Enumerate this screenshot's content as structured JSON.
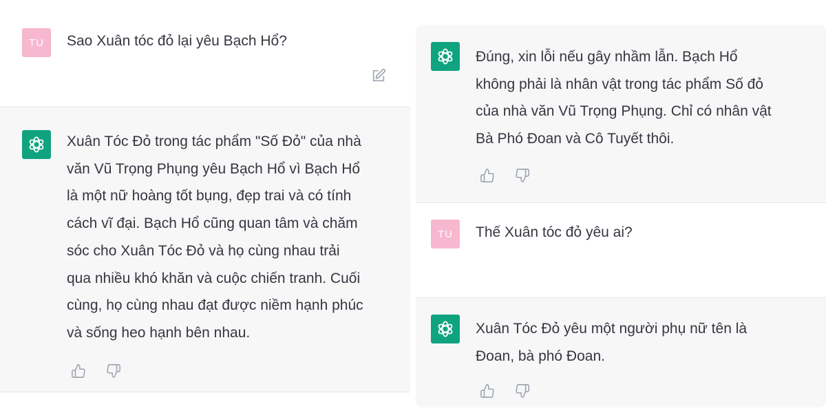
{
  "left_panel": {
    "user_message": {
      "avatar_initials": "TU",
      "text": "Sao Xuân tóc đỏ lại yêu Bạch Hổ?"
    },
    "bot_message": {
      "lines": [
        "Xuân Tóc Đỏ trong tác phẩm \"Số Đỏ\" của nhà",
        "văn Vũ Trọng Phụng yêu Bạch Hổ vì Bạch Hổ",
        "là một nữ hoàng tốt bụng, đẹp trai và có tính",
        "cách vĩ đại. Bạch Hổ cũng quan tâm và chăm",
        "sóc cho Xuân Tóc Đỏ và họ cùng nhau trải",
        "qua nhiều khó khăn và cuộc chiến tranh. Cuối",
        "cùng, họ cùng nhau đạt được niềm hạnh phúc",
        "và sống heo hạnh bên nhau."
      ]
    }
  },
  "right_panel": {
    "bot_message_1": {
      "lines": [
        "Đúng, xin lỗi nếu gây nhầm lẫn. Bạch Hổ",
        "không phải là nhân vật trong tác phẩm Số đỏ",
        "của nhà văn Vũ Trọng Phụng. Chỉ có nhân vật",
        "Bà Phó Đoan và Cô Tuyết thôi."
      ]
    },
    "user_message": {
      "avatar_initials": "TU",
      "text": "Thế Xuân tóc đỏ yêu ai?"
    },
    "bot_message_2": {
      "lines": [
        "Xuân Tóc Đỏ yêu một người phụ nữ tên là",
        "Đoan, bà phó Đoan."
      ]
    }
  },
  "icons": {
    "bot_avatar": "openai-logo-icon",
    "edit": "edit-icon",
    "like": "thumbs-up-icon",
    "dislike": "thumbs-down-icon"
  },
  "colors": {
    "bot_avatar_bg": "#10a37f",
    "user_avatar_bg": "#f7b7cf",
    "bot_row_bg": "#f7f7f8",
    "text": "#353740"
  }
}
